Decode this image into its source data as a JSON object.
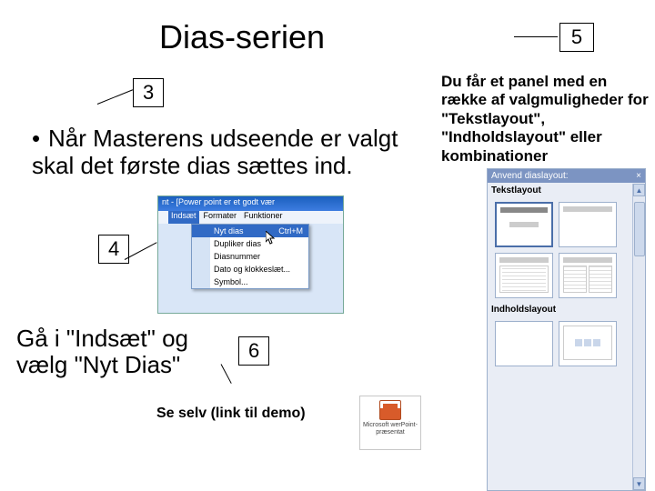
{
  "title": "Dias-serien",
  "steps": {
    "s3": "3",
    "s4": "4",
    "s5": "5",
    "s6": "6"
  },
  "bullet_main": "Når Masterens udseende er valgt skal det første dias sættes ind.",
  "instr_insert": "Gå i \"Indsæt\" og vælg \"Nyt Dias\"",
  "instr_demo": "Se selv (link til demo)",
  "desc_right": "Du får et panel med en række af valgmuligheder for \"Tekstlayout\", \"Indholdslayout\" eller kombinationer",
  "menu_window_title": "nt - [Power point er et godt vær",
  "menubar": [
    "",
    "Indsæt",
    "Formater",
    "Funktioner",
    ""
  ],
  "menu_items": [
    {
      "label": "Nyt dias",
      "accel": "Ctrl+M",
      "selected": true
    },
    {
      "label": "Dupliker dias"
    },
    {
      "label": "Diasnummer"
    },
    {
      "label": "Dato og klokkeslæt..."
    },
    {
      "label": "Symbol..."
    }
  ],
  "panel": {
    "header": "Anvend diaslayout:",
    "close": "×",
    "section1": "Tekstlayout",
    "section2": "Indholdslayout"
  },
  "ppt_icon_label": "Microsoft werPoint-præsentat"
}
